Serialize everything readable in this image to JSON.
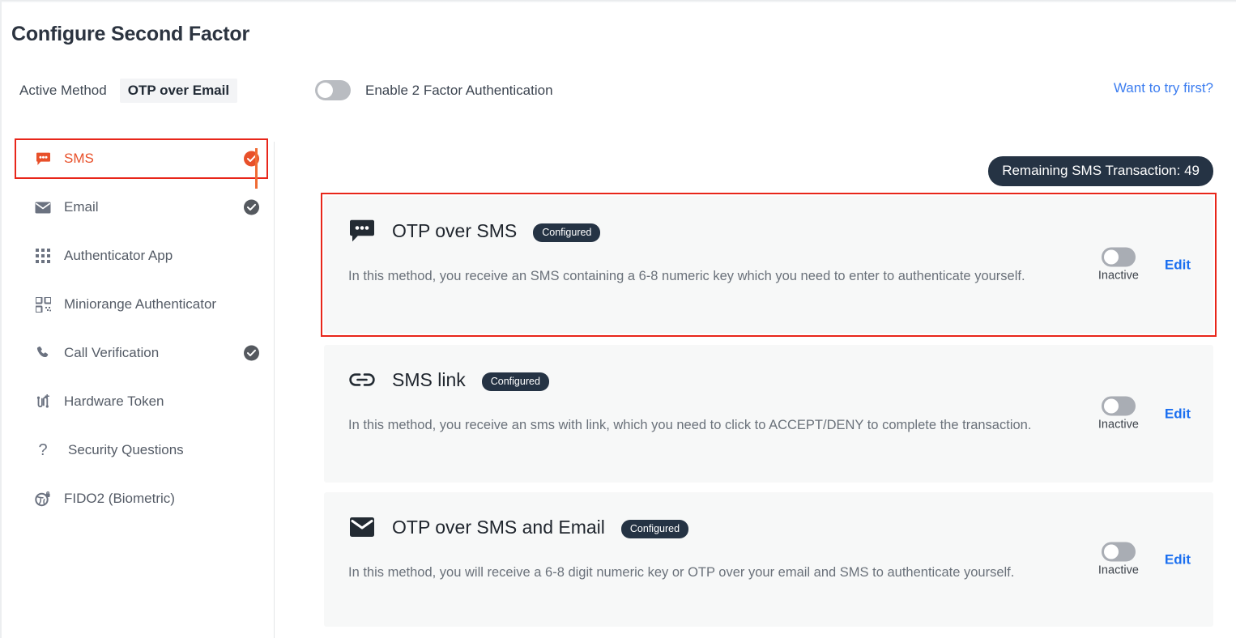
{
  "header": {
    "title": "Configure Second Factor",
    "active_method_label": "Active Method",
    "active_method_value": "OTP over Email",
    "enable_2fa_label": "Enable 2 Factor Authentication",
    "enable_2fa_state": "off",
    "try_link": "Want to try first?",
    "link_color": "#3c7df0"
  },
  "sidebar": {
    "items": [
      {
        "label": "SMS",
        "icon": "sms-bubble-icon",
        "checked": true,
        "active": true
      },
      {
        "label": "Email",
        "icon": "envelope-icon",
        "checked": true,
        "active": false
      },
      {
        "label": "Authenticator App",
        "icon": "grid-dots-icon",
        "checked": false,
        "active": false
      },
      {
        "label": "Miniorange Authenticator",
        "icon": "qr-code-icon",
        "checked": false,
        "active": false
      },
      {
        "label": "Call Verification",
        "icon": "phone-icon",
        "checked": true,
        "active": false
      },
      {
        "label": "Hardware Token",
        "icon": "hardware-token-icon",
        "checked": false,
        "active": false
      },
      {
        "label": "Security Questions",
        "icon": "question-mark-icon",
        "checked": false,
        "active": false
      },
      {
        "label": "FIDO2 (Biometric)",
        "icon": "fingerprint-key-icon",
        "checked": false,
        "active": false
      }
    ],
    "active_accent_color": "#e8502a",
    "highlight_color": "#e8261a"
  },
  "main": {
    "remaining_badge": "Remaining SMS Transaction: 49",
    "badge_color": "#253344",
    "cards": [
      {
        "title": "OTP over SMS",
        "icon": "sms-bubble-icon",
        "status_chip": "Configured",
        "description": "In this method, you receive an SMS containing a 6-8 numeric key which you need to enter to authenticate yourself.",
        "toggle_state": "off",
        "toggle_caption": "Inactive",
        "edit_label": "Edit",
        "highlighted": true
      },
      {
        "title": "SMS link",
        "icon": "link-icon",
        "status_chip": "Configured",
        "description": "In this method, you receive an sms with link, which you need to click to ACCEPT/DENY to complete the transaction.",
        "toggle_state": "off",
        "toggle_caption": "Inactive",
        "edit_label": "Edit",
        "highlighted": false
      },
      {
        "title": "OTP over SMS and Email",
        "icon": "envelope-icon",
        "status_chip": "Configured",
        "description": "In this method, you will receive a 6-8 digit numeric key or OTP over your email and SMS to authenticate yourself.",
        "toggle_state": "off",
        "toggle_caption": "Inactive",
        "edit_label": "Edit",
        "highlighted": false
      }
    ]
  }
}
